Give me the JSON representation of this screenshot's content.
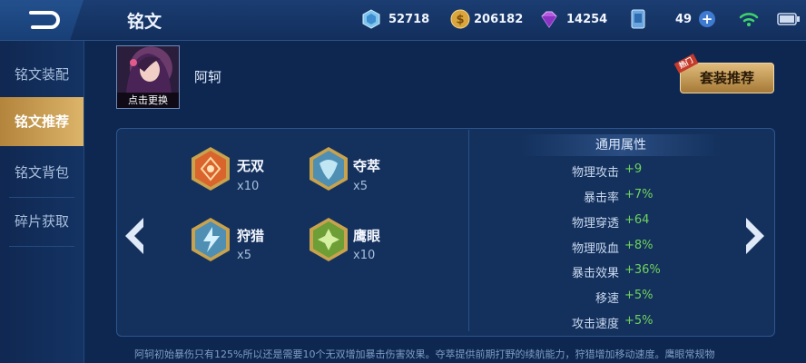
{
  "header": {
    "title": "铭文",
    "resources": [
      {
        "icon": "diamond-icon",
        "value": "52718"
      },
      {
        "icon": "gold-coin-icon",
        "value": "206182"
      },
      {
        "icon": "purple-crystal-icon",
        "value": "14254"
      },
      {
        "icon": "inscription-card-icon",
        "value": "49"
      }
    ],
    "plus_label": "+"
  },
  "sidebar": {
    "items": [
      {
        "label": "铭文装配",
        "active": false
      },
      {
        "label": "铭文推荐",
        "active": true
      },
      {
        "label": "铭文背包",
        "active": false
      },
      {
        "label": "碎片获取",
        "active": false
      }
    ]
  },
  "hero": {
    "name": "阿轲",
    "change_label": "点击更换"
  },
  "recommend_button": {
    "label": "套装推荐",
    "hot_tag": "热门"
  },
  "runes": [
    {
      "name": "无双",
      "count": "x10",
      "icon": "red-rune-icon",
      "color": "#d9642c"
    },
    {
      "name": "夺萃",
      "count": "x5",
      "icon": "blue-rune-icon",
      "color": "#7fc7e0"
    },
    {
      "name": "狩猎",
      "count": "x5",
      "icon": "blue-rune-icon",
      "color": "#7fc7e0"
    },
    {
      "name": "鹰眼",
      "count": "x10",
      "icon": "green-rune-icon",
      "color": "#8fc24a"
    }
  ],
  "attributes": {
    "title": "通用属性",
    "rows": [
      {
        "label": "物理攻击",
        "value": "+9"
      },
      {
        "label": "暴击率",
        "value": "+7%"
      },
      {
        "label": "物理穿透",
        "value": "+64"
      },
      {
        "label": "物理吸血",
        "value": "+8%"
      },
      {
        "label": "暴击效果",
        "value": "+36%"
      },
      {
        "label": "移速",
        "value": "+5%"
      },
      {
        "label": "攻击速度",
        "value": "+5%"
      }
    ]
  },
  "description": "阿轲初始暴伤只有125%所以还是需要10个无双增加暴击伤害效果。夺萃提供前期打野的续航能力，狩猎增加移动速度。鹰眼常规物",
  "colors": {
    "accent_gold": "#d9ad62",
    "value_green": "#6fd35d",
    "background": "#0d2750"
  }
}
